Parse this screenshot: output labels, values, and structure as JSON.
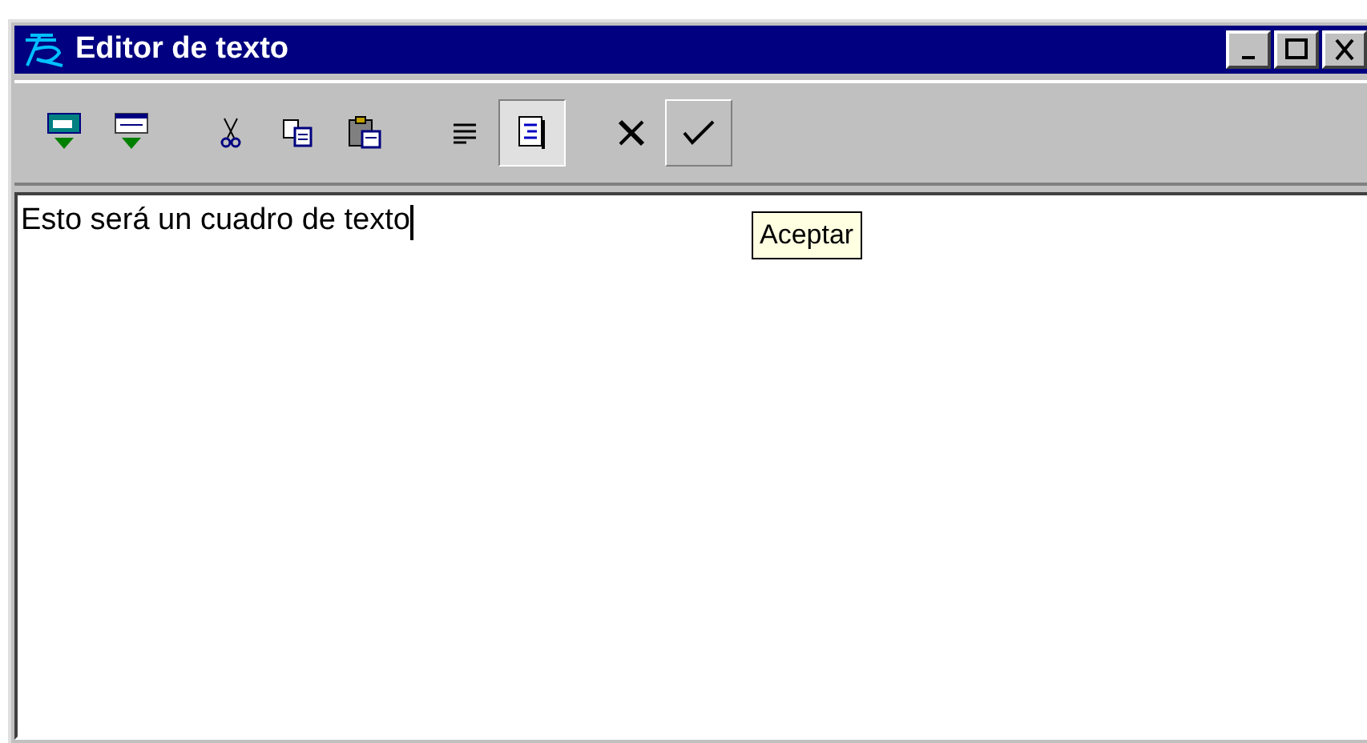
{
  "window": {
    "title": "Editor de texto"
  },
  "toolbar": [
    {
      "kind": "import",
      "pressed": false,
      "raised": false
    },
    {
      "kind": "import-table",
      "pressed": false,
      "raised": false
    },
    {
      "kind": "separator"
    },
    {
      "kind": "cut",
      "pressed": false,
      "raised": false
    },
    {
      "kind": "copy",
      "pressed": false,
      "raised": false
    },
    {
      "kind": "paste",
      "pressed": false,
      "raised": false
    },
    {
      "kind": "separator"
    },
    {
      "kind": "align",
      "pressed": false,
      "raised": false
    },
    {
      "kind": "wrap",
      "pressed": true,
      "raised": false
    },
    {
      "kind": "separator"
    },
    {
      "kind": "cancel",
      "pressed": false,
      "raised": false
    },
    {
      "kind": "accept",
      "pressed": false,
      "raised": true
    }
  ],
  "tooltip": {
    "text": "Aceptar"
  },
  "editor": {
    "value": "Esto será un cuadro de texto"
  }
}
